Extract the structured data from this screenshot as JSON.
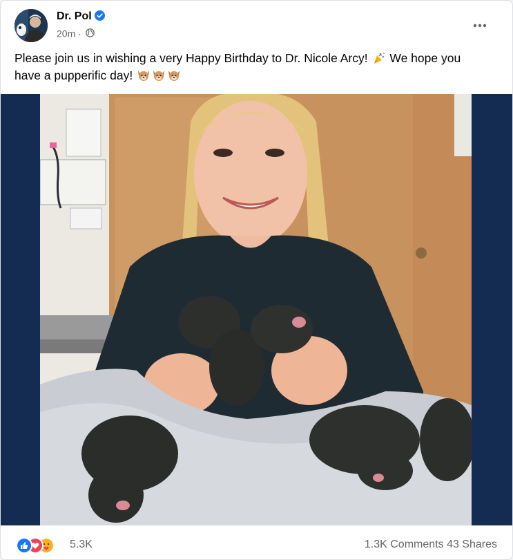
{
  "post": {
    "author": "Dr. Pol",
    "timestamp": "20m",
    "separator": "·",
    "caption_line1": "Please join us in wishing a very Happy Birthday to Dr. Nicole Arcy!",
    "caption_line1b": "We hope you",
    "caption_line2": "have a pupperific day!"
  },
  "icons": {
    "verified": "verified-badge-icon",
    "audience": "globe-icon",
    "more": "more-options-icon",
    "party": "party-popper-emoji",
    "dog": "dog-face-emoji"
  },
  "footer": {
    "reaction_count": "5.3K",
    "comments": "1.3K Comments",
    "shares": "43 Shares"
  },
  "colors": {
    "brand_blue": "#1877f2",
    "love_red": "#f33e58",
    "care_yellow": "#f7b125",
    "secondary_text": "#65676b",
    "media_backdrop": "#142c52"
  }
}
